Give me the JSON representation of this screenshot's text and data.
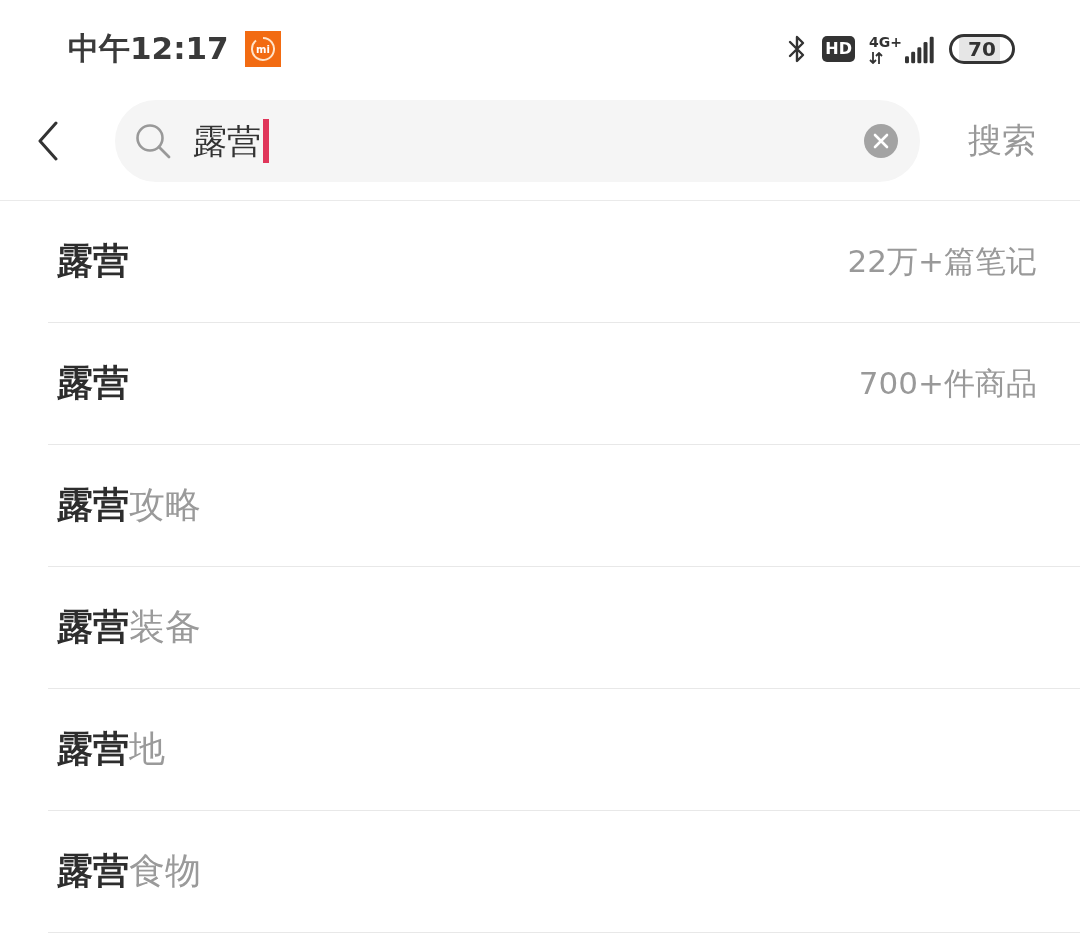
{
  "status_bar": {
    "time": "中午12:17",
    "app_badge": "mi",
    "hd": "HD",
    "network": "4G+",
    "battery": "70"
  },
  "search_bar": {
    "query": "露营",
    "search_button": "搜索"
  },
  "suggestions": [
    {
      "kind": "result",
      "text": "露营",
      "count": "22万+篇笔记"
    },
    {
      "kind": "result",
      "text": "露营",
      "count": "700+件商品"
    },
    {
      "kind": "completion",
      "text": "**露营**攻略"
    },
    {
      "kind": "completion",
      "text": "**露营**装备"
    },
    {
      "kind": "completion",
      "text": "**露营**地"
    },
    {
      "kind": "completion",
      "text": "**露营**食物"
    }
  ]
}
